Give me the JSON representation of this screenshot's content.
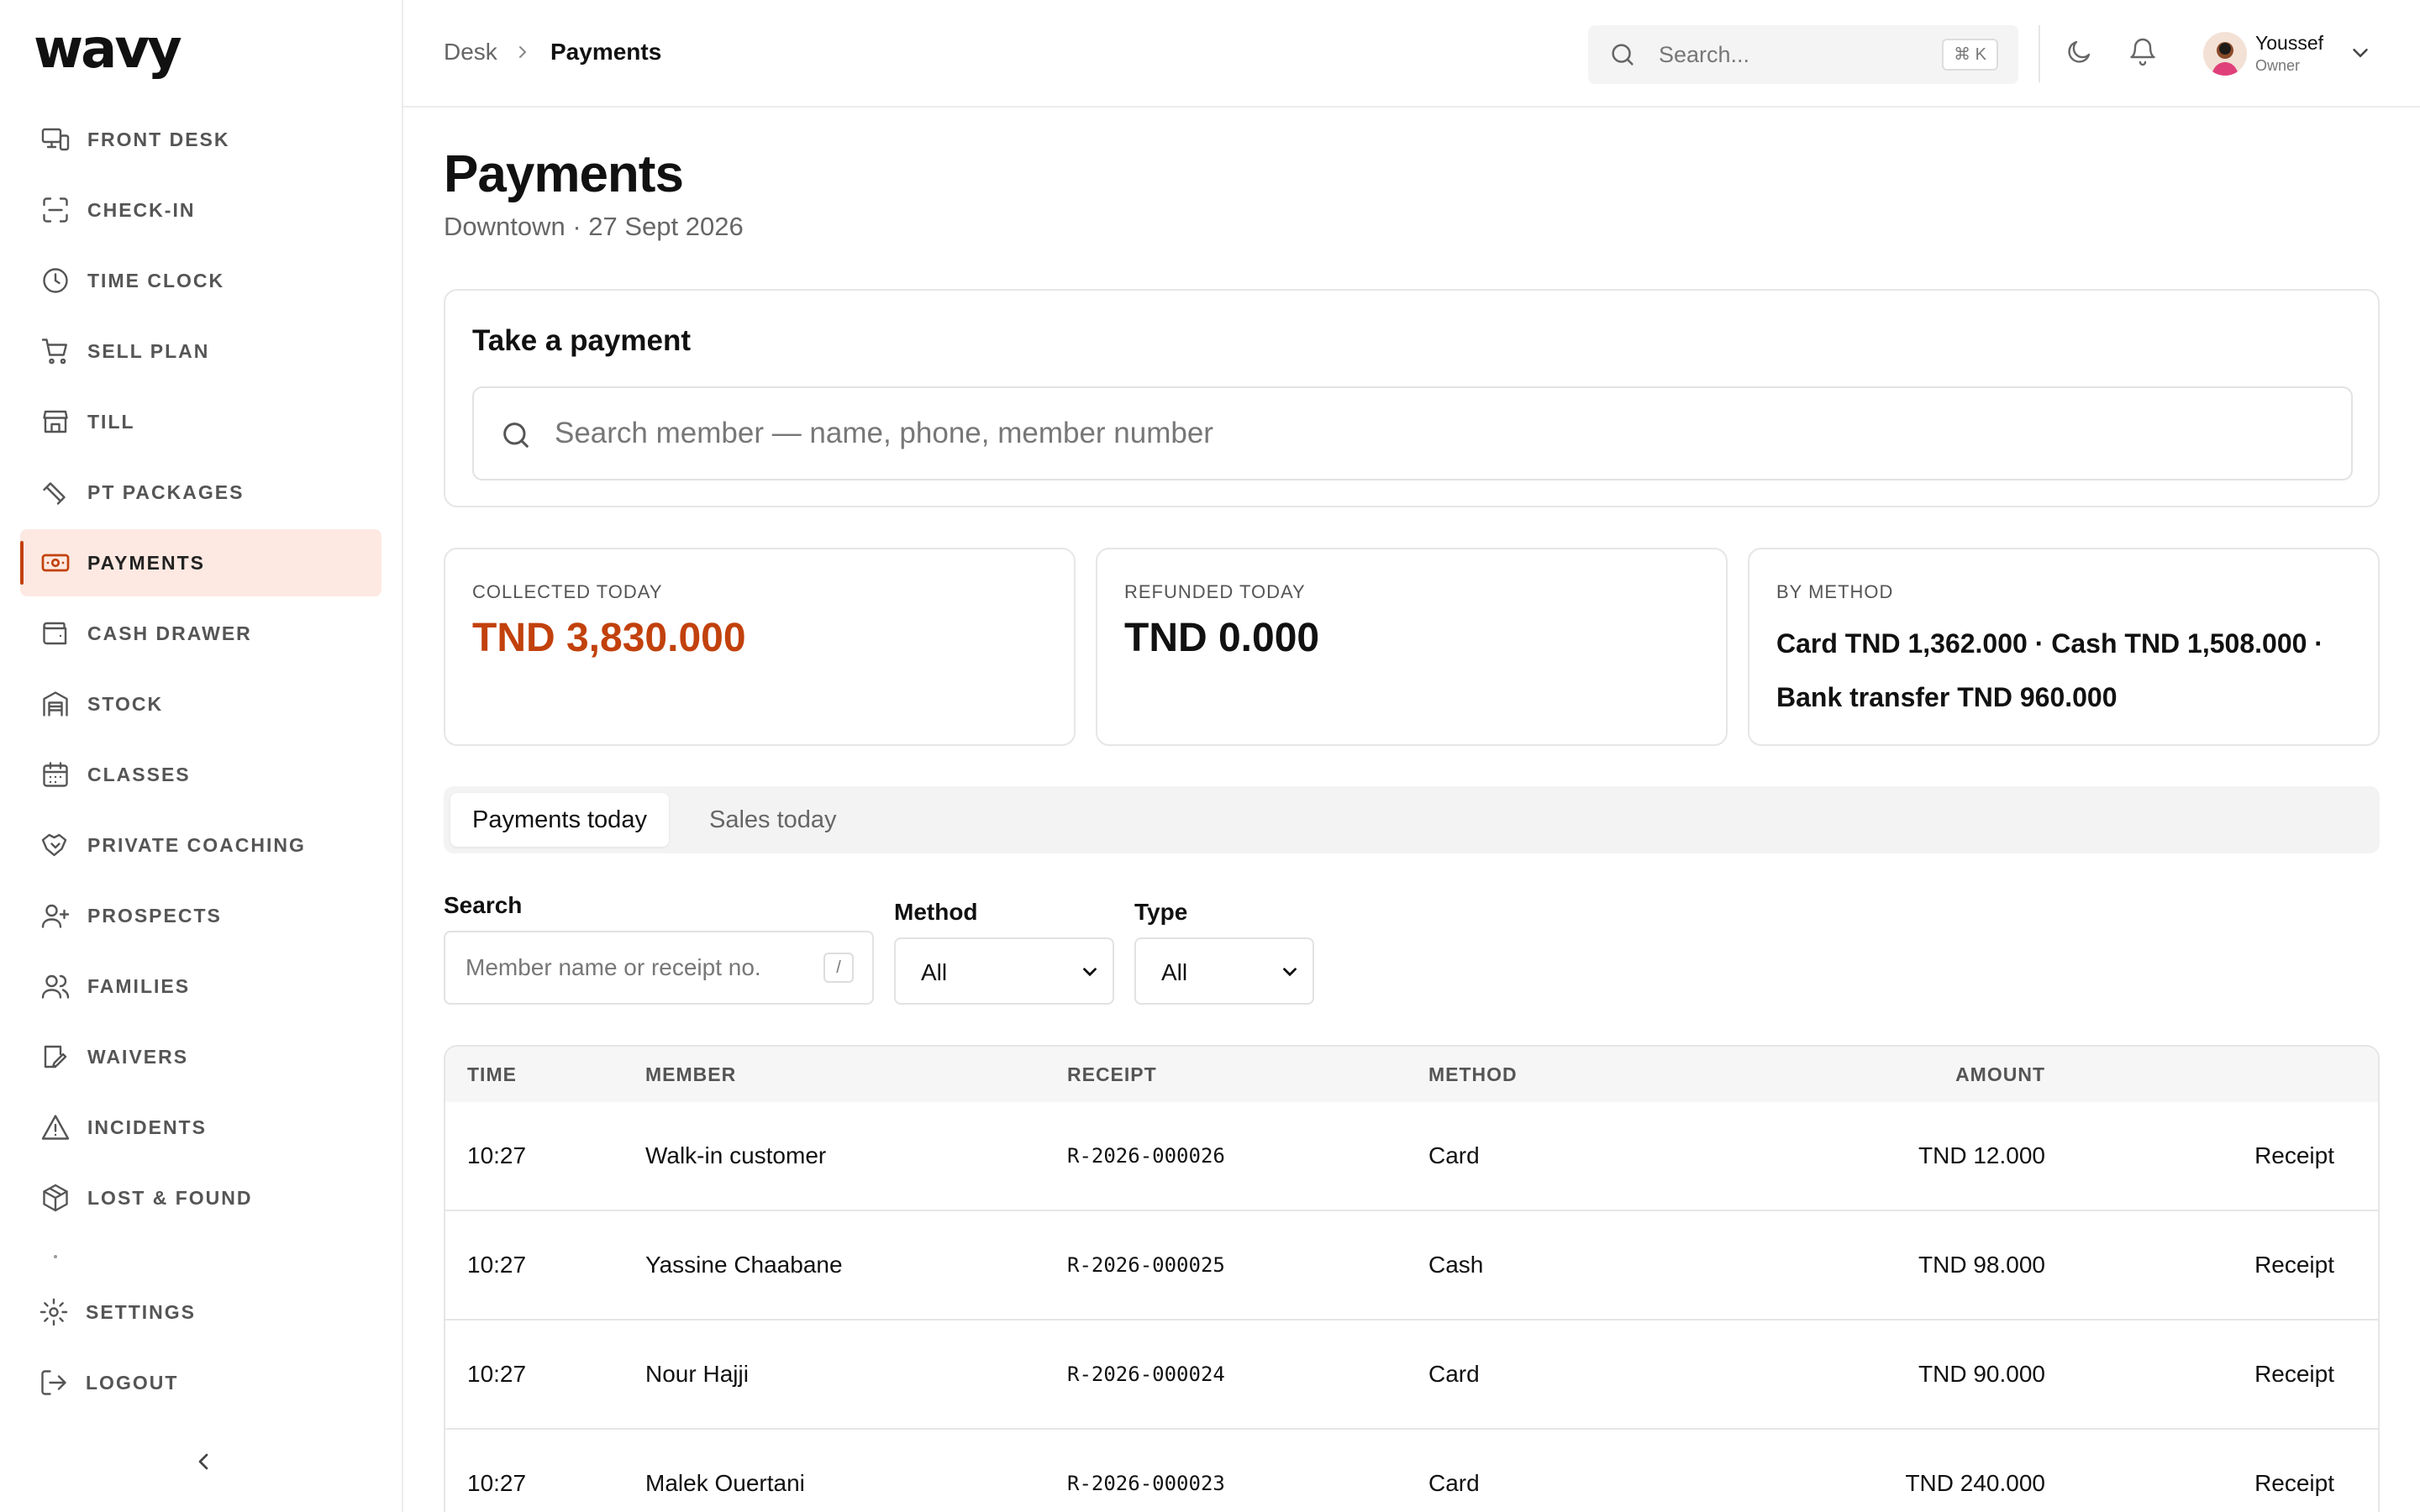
{
  "app": {
    "logo": "wavy"
  },
  "sidebar": {
    "items": [
      {
        "label": "FRONT DESK",
        "icon": "front-desk-icon"
      },
      {
        "label": "CHECK-IN",
        "icon": "scan-icon"
      },
      {
        "label": "TIME CLOCK",
        "icon": "clock-icon"
      },
      {
        "label": "SELL PLAN",
        "icon": "cart-icon"
      },
      {
        "label": "TILL",
        "icon": "store-icon"
      },
      {
        "label": "PT PACKAGES",
        "icon": "dumbbell-icon"
      },
      {
        "label": "PAYMENTS",
        "icon": "banknote-icon",
        "active": true
      },
      {
        "label": "CASH DRAWER",
        "icon": "wallet-icon"
      },
      {
        "label": "STOCK",
        "icon": "warehouse-icon"
      },
      {
        "label": "CLASSES",
        "icon": "calendar-icon"
      },
      {
        "label": "PRIVATE COACHING",
        "icon": "handshake-icon"
      },
      {
        "label": "PROSPECTS",
        "icon": "user-plus-icon"
      },
      {
        "label": "FAMILIES",
        "icon": "users-icon"
      },
      {
        "label": "WAIVERS",
        "icon": "signature-icon"
      },
      {
        "label": "INCIDENTS",
        "icon": "warning-icon"
      },
      {
        "label": "LOST & FOUND",
        "icon": "package-icon"
      }
    ],
    "bottom": [
      {
        "label": "SETTINGS",
        "icon": "gear-icon"
      },
      {
        "label": "LOGOUT",
        "icon": "logout-icon"
      }
    ],
    "accent": "#c2410c",
    "active_bg": "#fde9e2"
  },
  "header": {
    "breadcrumb": [
      "Desk",
      "Payments"
    ],
    "search_placeholder": "Search...",
    "shortcut": "⌘ K",
    "user": {
      "name": "Youssef",
      "role": "Owner"
    }
  },
  "page": {
    "title": "Payments",
    "subtitle": "Downtown · 27 Sept 2026"
  },
  "take_payment": {
    "title": "Take a payment",
    "placeholder": "Search member — name, phone, member number"
  },
  "stats": {
    "collected": {
      "label": "COLLECTED TODAY",
      "value": "TND 3,830.000"
    },
    "refunded": {
      "label": "REFUNDED TODAY",
      "value": "TND 0.000"
    },
    "by_method": {
      "label": "BY METHOD",
      "line1": "Card TND 1,362.000 · Cash TND 1,508.000 ·",
      "line2": "Bank transfer TND 960.000"
    }
  },
  "tabs": [
    {
      "label": "Payments today",
      "active": true
    },
    {
      "label": "Sales today",
      "active": false
    }
  ],
  "filters": {
    "search_label": "Search",
    "search_placeholder": "Member name or receipt no.",
    "search_shortcut": "/",
    "method_label": "Method",
    "method_value": "All",
    "type_label": "Type",
    "type_value": "All"
  },
  "table": {
    "columns": [
      "TIME",
      "MEMBER",
      "RECEIPT",
      "METHOD",
      "AMOUNT"
    ],
    "rows": [
      {
        "time": "10:27",
        "member": "Walk-in customer",
        "receipt": "R-2026-000026",
        "method": "Card",
        "amount": "TND 12.000",
        "action": "Receipt"
      },
      {
        "time": "10:27",
        "member": "Yassine Chaabane",
        "receipt": "R-2026-000025",
        "method": "Cash",
        "amount": "TND 98.000",
        "action": "Receipt"
      },
      {
        "time": "10:27",
        "member": "Nour Hajji",
        "receipt": "R-2026-000024",
        "method": "Card",
        "amount": "TND 90.000",
        "action": "Receipt"
      },
      {
        "time": "10:27",
        "member": "Malek Ouertani",
        "receipt": "R-2026-000023",
        "method": "Card",
        "amount": "TND 240.000",
        "action": "Receipt"
      }
    ]
  }
}
